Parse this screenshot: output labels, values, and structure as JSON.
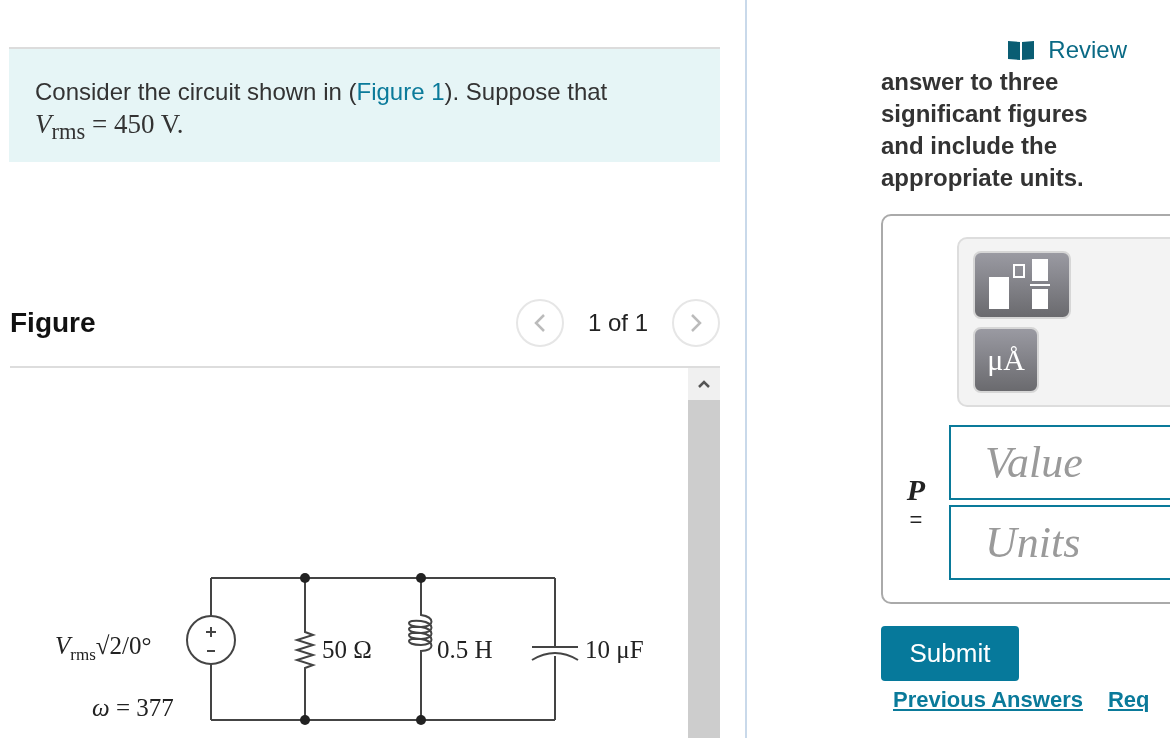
{
  "problem": {
    "before": "Consider the circuit shown in (",
    "link": "Figure 1",
    "after": "). Suppose that",
    "line2": "*V*$_{rms}$ = 450 V."
  },
  "figure": {
    "title": "Figure",
    "pager": "1 of 1",
    "labels": [
      {
        "kind": "source",
        "text": "*V*$_{rms}$√2/0°"
      },
      {
        "kind": "omega",
        "text": "*ω* = 377"
      },
      {
        "kind": "resistor",
        "text": "50 Ω"
      },
      {
        "kind": "inductor",
        "text": "0.5 H"
      },
      {
        "kind": "capacitor",
        "text": "10 μF"
      }
    ]
  },
  "review": "Review",
  "instructions": "answer to three significant figures and include the appropriate units.",
  "answer": {
    "units_button": "μÅ",
    "variable": "P",
    "equals": "=",
    "value_placeholder": "Value",
    "units_placeholder": "Units"
  },
  "submit": "Submit",
  "links": [
    "Previous Answers",
    "Req"
  ]
}
